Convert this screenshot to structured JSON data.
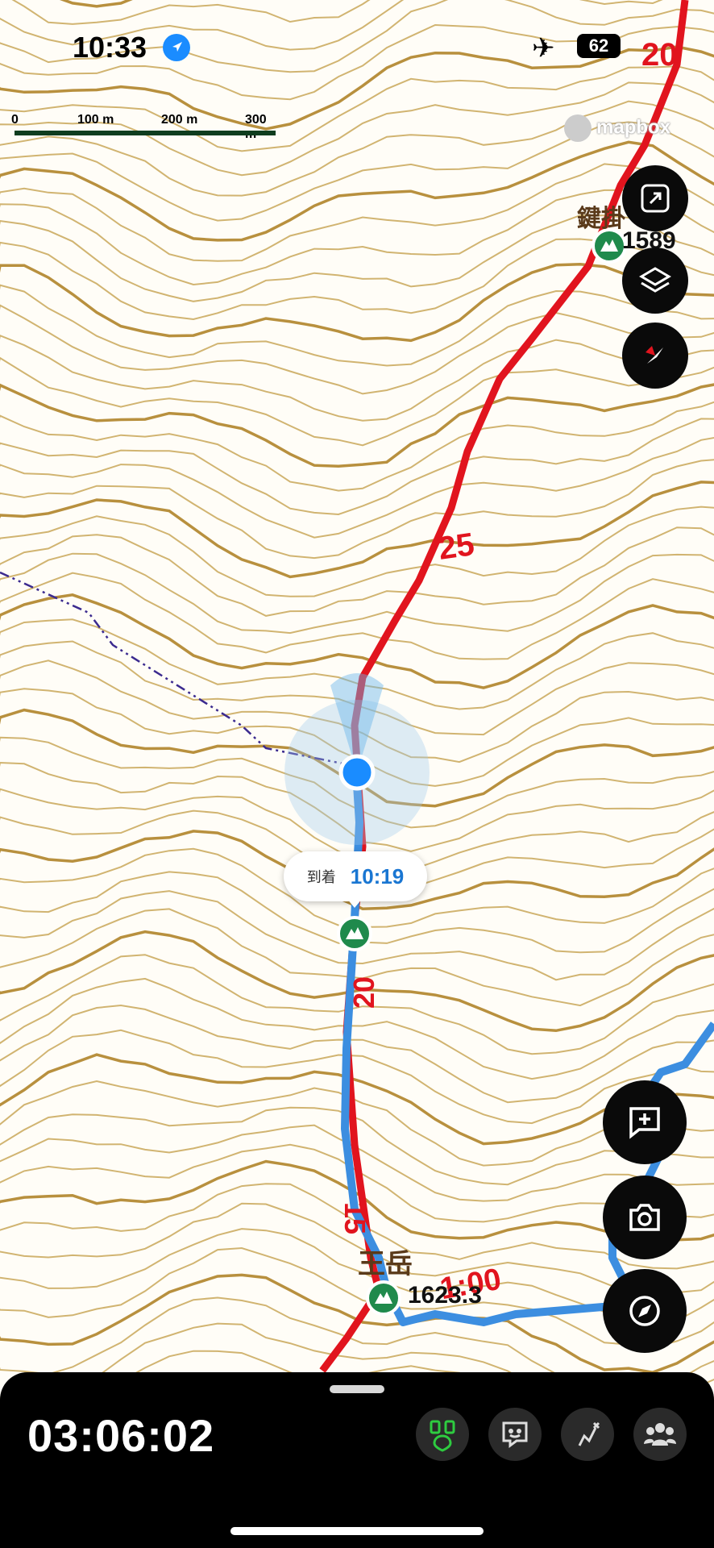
{
  "status_bar": {
    "time": "10:33",
    "battery": "62",
    "icons": [
      "location-arrow-icon",
      "airplane-icon",
      "battery-icon"
    ]
  },
  "map": {
    "scale_labels": [
      "0",
      "100 m",
      "200 m",
      "300 m"
    ],
    "attribution": "mapbox",
    "route_markers": [
      "20",
      "25",
      "20",
      "15",
      "1:00"
    ],
    "peaks": [
      {
        "name": "鍵掛",
        "elevation": "1589"
      },
      {
        "name": "王岳",
        "elevation": "1623.3"
      },
      {
        "name": "",
        "elevation": ""
      }
    ],
    "arrival_callout": {
      "label": "到着",
      "time": "10:19"
    },
    "colors": {
      "route_red": "#e1141e",
      "track_blue": "#3c8ee0",
      "contour": "#c7a453",
      "peak_green": "#1f8a4c",
      "location": "#1a8cff"
    }
  },
  "controls": {
    "right": [
      "expand-icon",
      "layers-icon",
      "compass-icon",
      "add-note-icon",
      "camera-icon",
      "recenter-icon"
    ]
  },
  "bottom_panel": {
    "elapsed": "03:06:02",
    "tools": [
      "hiking-tracker-icon",
      "chat-icon",
      "route-edit-icon",
      "group-icon"
    ],
    "active_tool_color": "#2ecc40"
  }
}
